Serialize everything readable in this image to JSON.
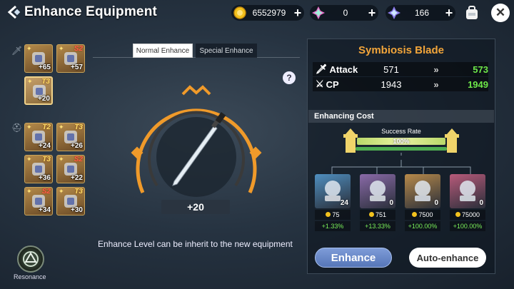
{
  "header": {
    "title": "Enhance Equipment",
    "gold": "6552979",
    "crystal": "0",
    "star": "166"
  },
  "inventory": {
    "weapons": [
      {
        "level": "+65",
        "tier": "",
        "icon": "spellbook-icon"
      },
      {
        "level": "+57",
        "tier": "S2",
        "icon": "gauntlet-icon"
      },
      {
        "level": "+20",
        "tier": "T3",
        "icon": "sword-icon",
        "selected": true
      }
    ],
    "armor": [
      {
        "level": "+24",
        "tier": "T2",
        "icon": "helmet-icon"
      },
      {
        "level": "+26",
        "tier": "T3",
        "icon": "glove-icon"
      },
      {
        "level": "+36",
        "tier": "T3",
        "icon": "robe-icon"
      },
      {
        "level": "+22",
        "tier": "S2",
        "icon": "chest-armor-icon"
      },
      {
        "level": "+34",
        "tier": "S2",
        "icon": "shoe-icon"
      },
      {
        "level": "+30",
        "tier": "T3",
        "icon": "boots-icon"
      }
    ]
  },
  "tabs": {
    "normal": "Normal Enhance",
    "special": "Special Enhance"
  },
  "center": {
    "help": "?",
    "level": "+20",
    "note": "Enhance Level can be inherit to the new equipment"
  },
  "resonance": {
    "label": "Resonance"
  },
  "item": {
    "name": "Symbiosis Blade",
    "stats": [
      {
        "name": "Attack",
        "old": "571",
        "new": "573",
        "icon": "sword-stat-icon"
      },
      {
        "name": "CP",
        "old": "1943",
        "new": "1949",
        "icon": "cp-icon"
      }
    ]
  },
  "cost": {
    "header": "Enhancing Cost",
    "rate_label": "Success Rate",
    "rate_value": "100%",
    "rate_fraction": 1.0,
    "materials": [
      {
        "count": "24",
        "price": "75",
        "bonus": "+1.33%",
        "color": "#4f8fc0"
      },
      {
        "count": "0",
        "price": "751",
        "bonus": "+13.33%",
        "color": "#8a6aa8"
      },
      {
        "count": "0",
        "price": "7500",
        "bonus": "+100.00%",
        "color": "#b88a4a"
      },
      {
        "count": "0",
        "price": "75000",
        "bonus": "+100.00%",
        "color": "#b85a7a"
      }
    ]
  },
  "buttons": {
    "enhance": "Enhance",
    "auto": "Auto-enhance"
  },
  "colors": {
    "accent_gold": "#f2a53a",
    "stat_up": "#6ee84a",
    "bonus": "#7af05a"
  }
}
